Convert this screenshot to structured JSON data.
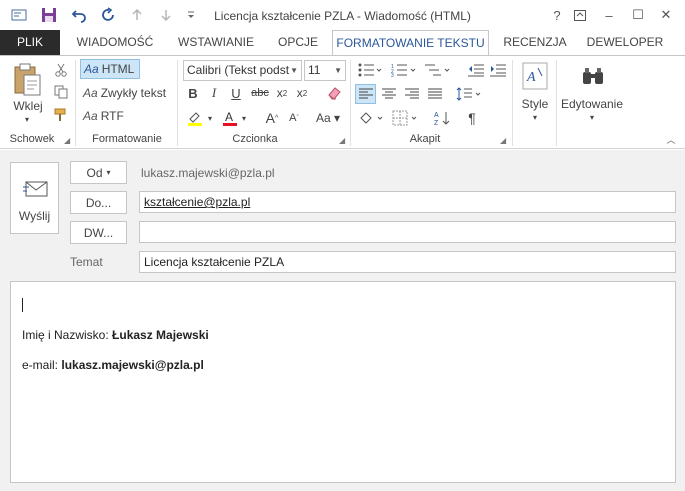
{
  "window": {
    "title": "Licencja kształcenie PZLA - Wiadomość (HTML)",
    "buttons": [
      "?",
      "⧉",
      "–",
      "☐",
      "✕"
    ]
  },
  "tabs": [
    {
      "label": "PLIK"
    },
    {
      "label": "WIADOMOŚĆ"
    },
    {
      "label": "WSTAWIANIE"
    },
    {
      "label": "OPCJE"
    },
    {
      "label": "FORMATOWANIE TEKSTU"
    },
    {
      "label": "RECENZJA"
    },
    {
      "label": "DEWELOPER"
    }
  ],
  "ribbon": {
    "clipboard": {
      "paste_label": "Wklej",
      "group_label": "Schowek"
    },
    "format": {
      "html_label": "HTML",
      "plain_label": "Zwykły tekst",
      "rtf_label": "RTF",
      "prefix": "Aa",
      "group_label": "Formatowanie"
    },
    "font": {
      "font_name": "Calibri (Tekst podst",
      "font_size": "11",
      "group_label": "Czcionka"
    },
    "paragraph": {
      "group_label": "Akapit"
    },
    "styles": {
      "label": "Style"
    },
    "editing": {
      "label": "Edytowanie"
    }
  },
  "compose": {
    "send_label": "Wyślij",
    "from_button": "Od",
    "from_value": "lukasz.majewski@pzla.pl",
    "to_button": "Do...",
    "to_value": "kształcenie@pzla.pl",
    "cc_button": "DW...",
    "cc_value": "",
    "subject_label": "Temat",
    "subject_value": "Licencja kształcenie PZLA"
  },
  "body": {
    "name_label": "Imię i Nazwisko:",
    "name_value": "Łukasz Majewski",
    "email_label": "e-mail:",
    "email_value": "lukasz.majewski@pzla.pl"
  }
}
